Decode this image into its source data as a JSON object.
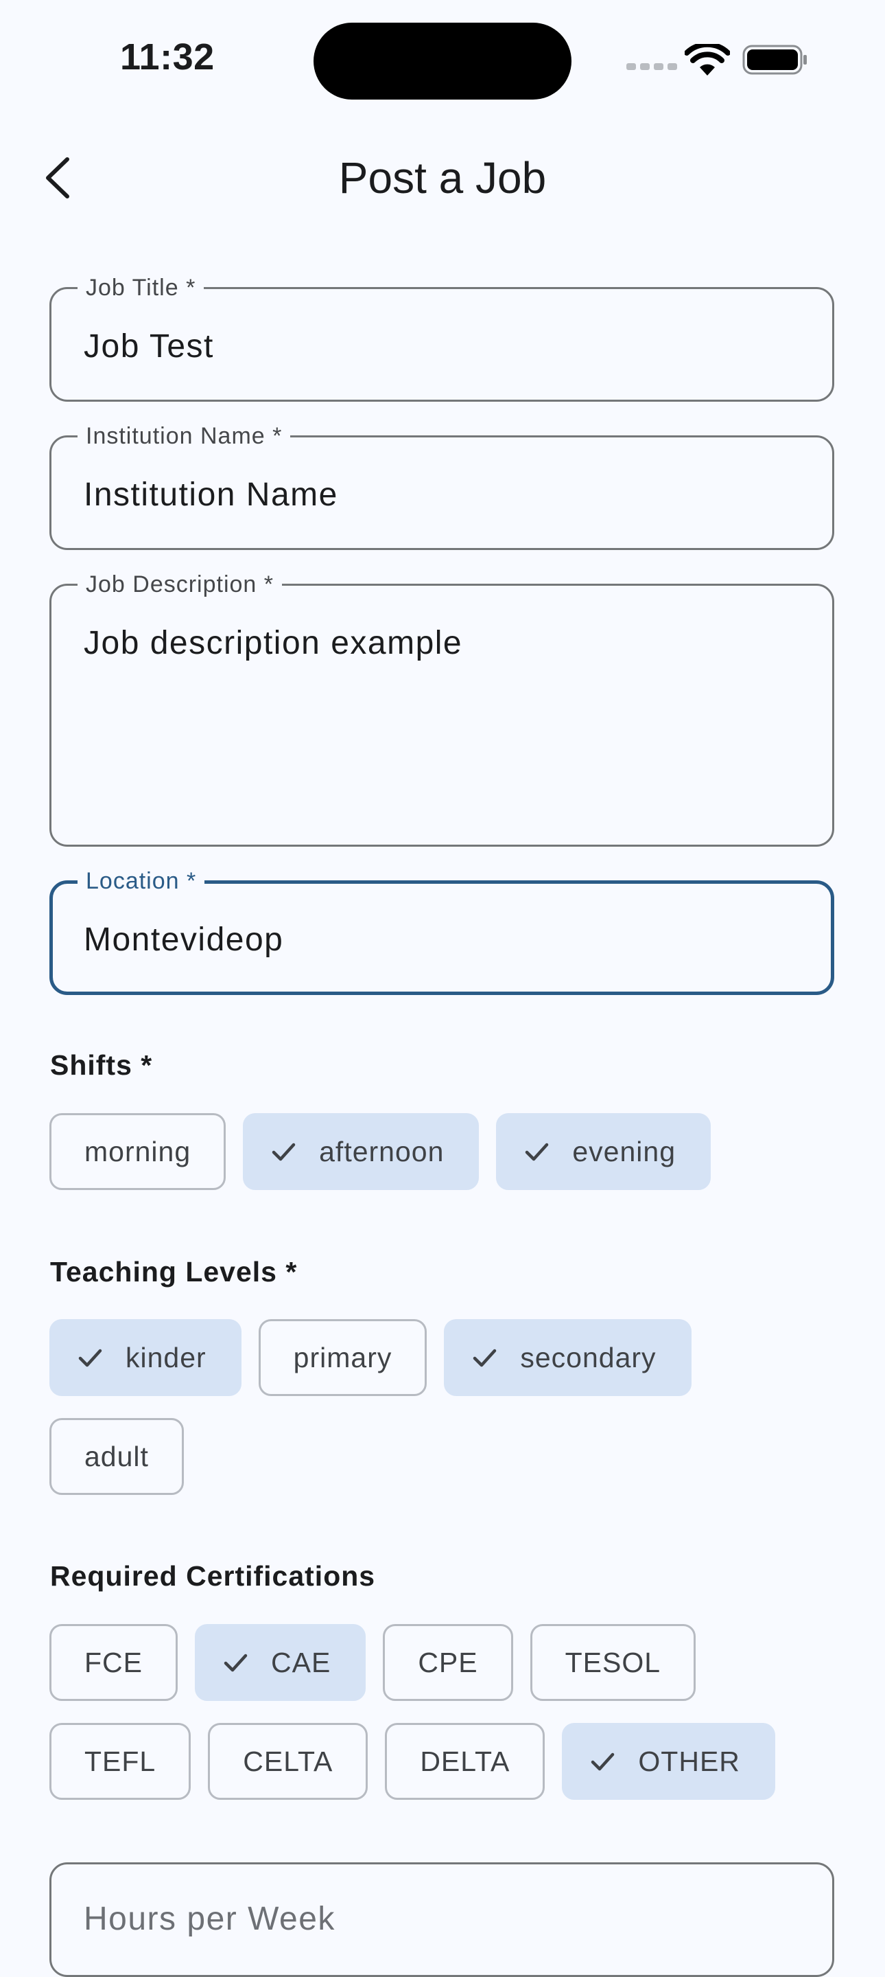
{
  "status_bar": {
    "time": "11:32"
  },
  "app_bar": {
    "title": "Post a Job"
  },
  "fields": {
    "job_title": {
      "label": "Job Title *",
      "value": "Job Test"
    },
    "institution_name": {
      "label": "Institution Name *",
      "value": "Institution Name"
    },
    "job_description": {
      "label": "Job Description *",
      "value": "Job description example"
    },
    "location": {
      "label": "Location *",
      "value": "Montevideop"
    },
    "hours_per_week": {
      "placeholder": "Hours per Week"
    }
  },
  "shifts": {
    "heading": "Shifts *",
    "options": [
      {
        "label": "morning",
        "selected": false
      },
      {
        "label": "afternoon",
        "selected": true
      },
      {
        "label": "evening",
        "selected": true
      }
    ]
  },
  "teaching_levels": {
    "heading": "Teaching Levels *",
    "options": [
      {
        "label": "kinder",
        "selected": true
      },
      {
        "label": "primary",
        "selected": false
      },
      {
        "label": "secondary",
        "selected": true
      },
      {
        "label": "adult",
        "selected": false
      }
    ]
  },
  "certifications": {
    "heading": "Required Certifications",
    "options": [
      {
        "label": "FCE",
        "selected": false
      },
      {
        "label": "CAE",
        "selected": true
      },
      {
        "label": "CPE",
        "selected": false
      },
      {
        "label": "TESOL",
        "selected": false
      },
      {
        "label": "TEFL",
        "selected": false
      },
      {
        "label": "CELTA",
        "selected": false
      },
      {
        "label": "DELTA",
        "selected": false
      },
      {
        "label": "OTHER",
        "selected": true
      }
    ]
  },
  "icons": {
    "back": "chevron-left-icon",
    "check": "check-icon",
    "wifi": "wifi-icon",
    "battery": "battery-icon",
    "signal": "cellular-signal-icon"
  },
  "colors": {
    "focus_outline": "#2a5b87",
    "selected_chip": "#d6e3f5",
    "background": "#f8faff"
  }
}
